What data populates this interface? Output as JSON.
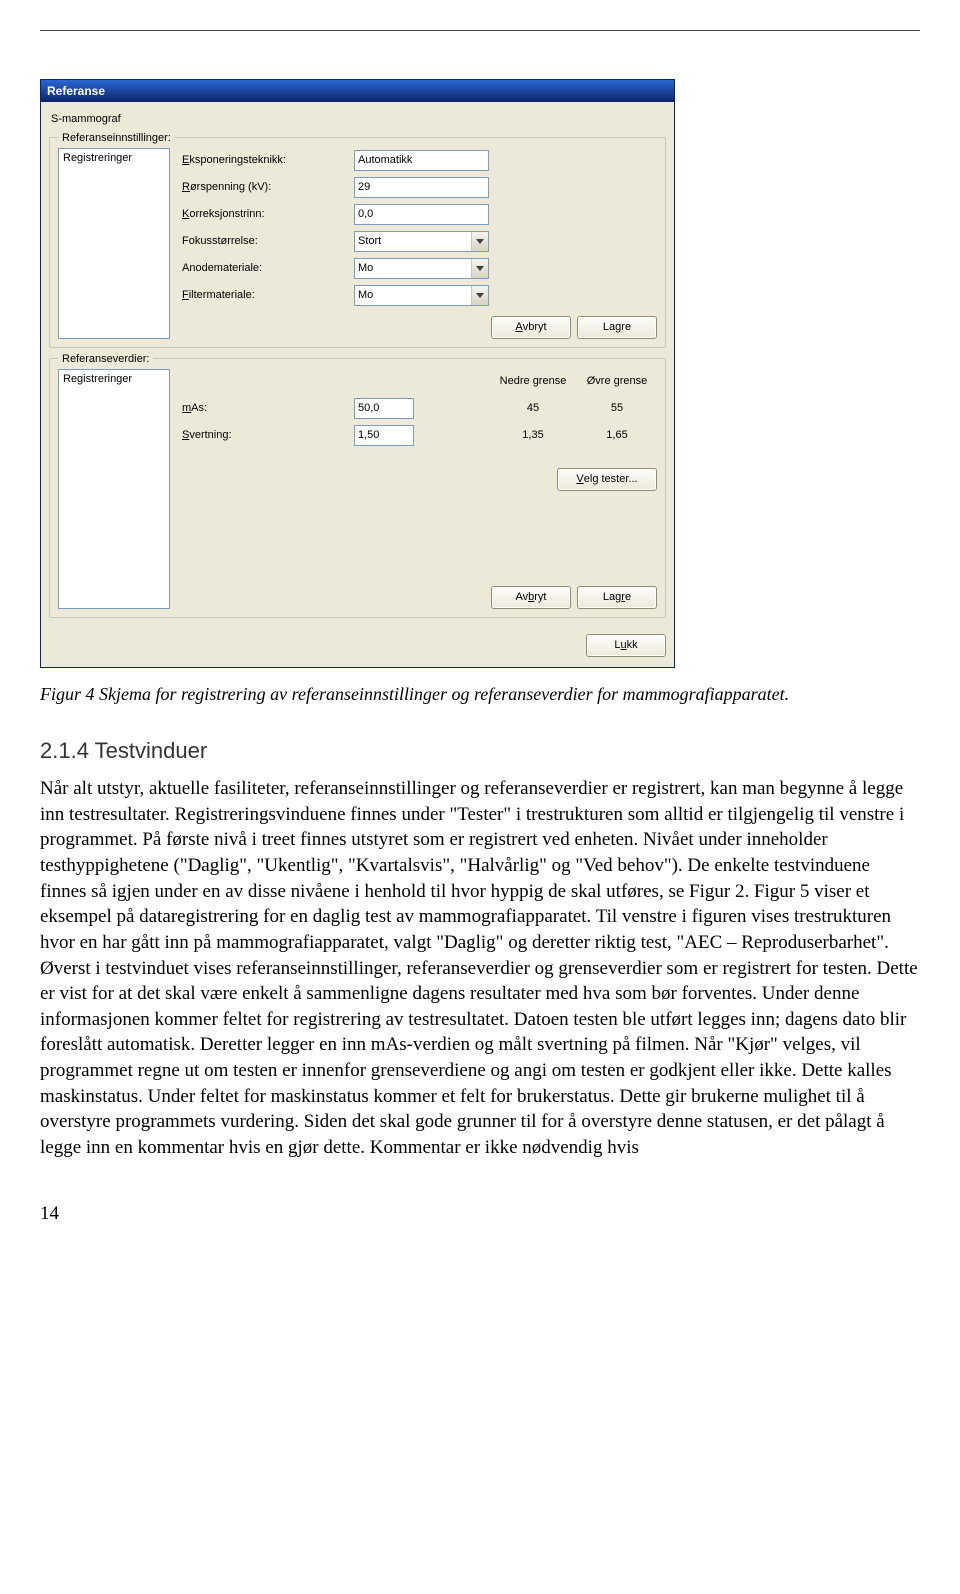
{
  "window": {
    "title": "Referanse",
    "topLabel": "S-mammograf",
    "group1": {
      "legend": "Referanseinnstillinger:",
      "listHeader": "Registreringer",
      "fields": {
        "eksponering_label": "Eksponeringsteknikk:",
        "eksponering_value": "Automatikk",
        "rorspenning_label": "Rørspenning (kV):",
        "rorspenning_value": "29",
        "korreksjon_label": "Korreksjonstrinn:",
        "korreksjon_value": "0,0",
        "fokus_label": "Fokusstørrelse:",
        "fokus_value": "Stort",
        "anode_label": "Anodemateriale:",
        "anode_value": "Mo",
        "filter_label": "Filtermateriale:",
        "filter_value": "Mo"
      },
      "buttons": {
        "cancel": "Avbryt",
        "save": "Lagre"
      }
    },
    "group2": {
      "legend": "Referanseverdier:",
      "listHeader": "Registreringer",
      "cols": {
        "nedre": "Nedre grense",
        "ovre": "Øvre grense"
      },
      "rows": {
        "mas_label": "mAs:",
        "mas_value": "50,0",
        "mas_nedre": "45",
        "mas_ovre": "55",
        "svert_label": "Svertning:",
        "svert_value": "1,50",
        "svert_nedre": "1,35",
        "svert_ovre": "1,65"
      },
      "buttons": {
        "velg": "Velg tester...",
        "cancel": "Avbryt",
        "save": "Lagre"
      }
    },
    "closeBtn": "Lukk"
  },
  "caption": "Figur 4 Skjema for registrering av referanseinnstillinger og referanseverdier for mammografiapparatet.",
  "section": {
    "heading": "2.1.4  Testvinduer",
    "para": "Når alt utstyr, aktuelle fasiliteter, referanseinnstillinger og referanseverdier er registrert, kan man begynne å legge inn testresultater. Registreringsvinduene finnes under \"Tester\" i trestrukturen som alltid er tilgjengelig til venstre i programmet. På første nivå i treet finnes utstyret som er registrert ved enheten. Nivået under inneholder testhyppighetene (\"Daglig\", \"Ukentlig\", \"Kvartalsvis\", \"Halvårlig\" og \"Ved behov\"). De enkelte testvinduene finnes så igjen under en av disse nivåene i henhold til hvor hyppig de skal utføres, se Figur 2.\nFigur 5 viser et eksempel på dataregistrering for en daglig test av mammografiapparatet. Til venstre i figuren vises trestrukturen hvor en har gått inn på mammografiapparatet, valgt \"Daglig\" og deretter riktig test, \"AEC – Reproduserbarhet\". Øverst i testvinduet vises referanseinnstillinger, referanseverdier og grenseverdier som er registrert for testen. Dette er vist for at det skal være enkelt å sammenligne dagens resultater med hva som bør forventes. Under denne informasjonen kommer feltet for registrering av testresultatet. Datoen testen ble utført legges inn; dagens dato blir foreslått automatisk. Deretter legger en inn mAs-verdien og målt svertning på filmen. Når \"Kjør\" velges, vil programmet regne ut om testen er innenfor grenseverdiene og angi om testen er godkjent eller ikke. Dette kalles maskinstatus. Under feltet for maskinstatus kommer et felt for brukerstatus. Dette gir brukerne mulighet til å overstyre programmets vurdering. Siden det skal gode grunner til for å overstyre denne statusen, er det pålagt å legge inn en kommentar hvis en gjør dette. Kommentar er ikke nødvendig hvis"
  },
  "pageNumber": "14"
}
